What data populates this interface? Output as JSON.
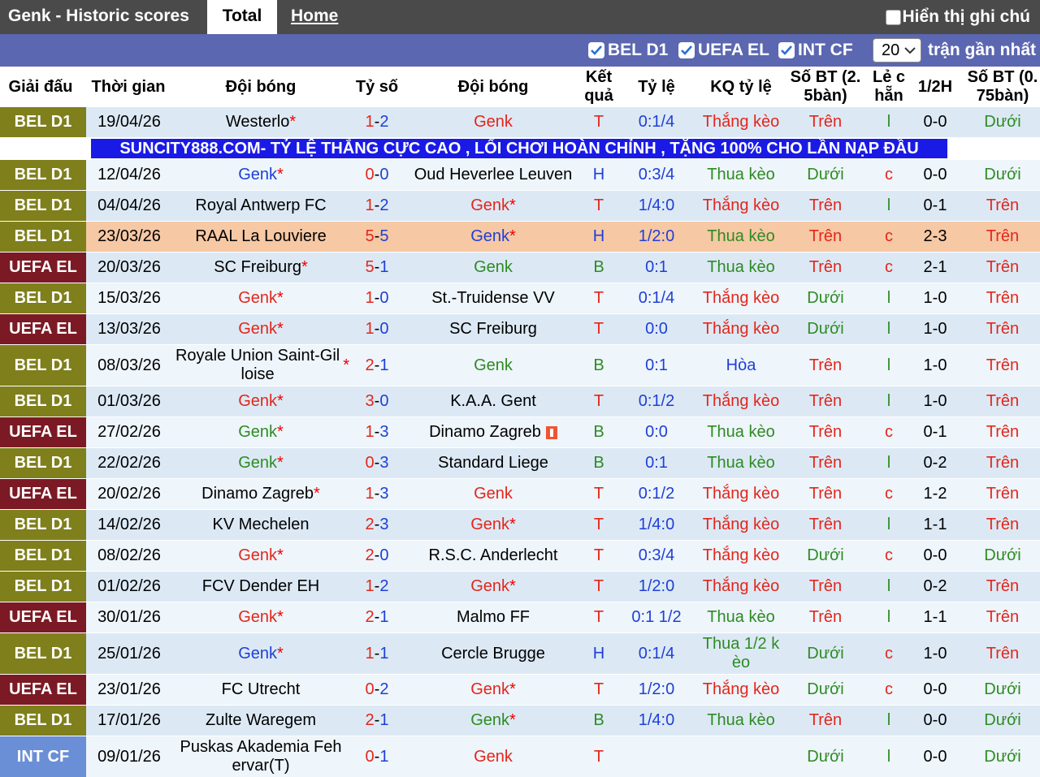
{
  "header": {
    "title": "Genk - Historic scores",
    "tab_total": "Total",
    "tab_home": "Home",
    "show_notes": "Hiển thị ghi chú"
  },
  "filters": {
    "items": [
      "BEL D1",
      "UEFA EL",
      "INT CF"
    ],
    "count_value": "20",
    "count_suffix": "trận gần nhất"
  },
  "columns": {
    "league": "Giải đấu",
    "time": "Thời gian",
    "home": "Đội bóng",
    "score": "Tỷ số",
    "away": "Đội bóng",
    "result": "Kết quả",
    "odds": "Tỷ lệ",
    "odds_result": "KQ tỷ lệ",
    "goals25": "Số BT (2. 5bàn)",
    "oddeven": "Lẻ c hẵn",
    "half": "1/2H",
    "goals075": "Số BT (0. 75bàn)"
  },
  "banner": "SUNCITY888.COM- TỶ LỆ THẮNG CỰC CAO , LỐI CHƠI HOÀN CHỈNH , TẶNG 100% CHO LẦN NẠP ĐẦU",
  "colors": {
    "bel_d1": "#7f7f1c",
    "uefa_el": "#7b1a24",
    "int_cf": "#6b8fd6",
    "row_light": "#dce9f5",
    "row_white": "#eef5fb",
    "row_highlight": "#f6c8a4",
    "red": "#e3261b",
    "blue": "#1f3fd6",
    "green": "#2e8b22"
  },
  "matches": [
    {
      "league": "BEL D1",
      "lt": "bel",
      "date": "19/04/26",
      "home": "Westerlo",
      "hs": true,
      "hc": "k",
      "score_h": "1",
      "score_a": "2",
      "away": "Genk",
      "as": false,
      "ac": "r",
      "res": "T",
      "rc": "r",
      "odds": "0:1/4",
      "kq": "Thắng kèo",
      "kc": "r",
      "g25": "Trên",
      "gc": "r",
      "oe": "l",
      "oc": "g",
      "half": "0-0",
      "g075": "Dưới",
      "g2c": "g",
      "bg": "light",
      "banner_after": true
    },
    {
      "league": "BEL D1",
      "lt": "bel",
      "date": "12/04/26",
      "home": "Genk",
      "hs": true,
      "hc": "b",
      "score_h": "0",
      "score_a": "0",
      "away": "Oud Heverlee Leuven",
      "as": false,
      "ac": "k",
      "res": "H",
      "rc": "b",
      "odds": "0:3/4",
      "kq": "Thua kèo",
      "kc": "g",
      "g25": "Dưới",
      "gc": "g",
      "oe": "c",
      "oc": "r",
      "half": "0-0",
      "g075": "Dưới",
      "g2c": "g",
      "bg": "white"
    },
    {
      "league": "BEL D1",
      "lt": "bel",
      "date": "04/04/26",
      "home": "Royal Antwerp FC",
      "hs": false,
      "hc": "k",
      "score_h": "1",
      "score_a": "2",
      "away": "Genk",
      "as": true,
      "ac": "r",
      "res": "T",
      "rc": "r",
      "odds": "1/4:0",
      "kq": "Thắng kèo",
      "kc": "r",
      "g25": "Trên",
      "gc": "r",
      "oe": "l",
      "oc": "g",
      "half": "0-1",
      "g075": "Trên",
      "g2c": "r",
      "bg": "light"
    },
    {
      "league": "BEL D1",
      "lt": "bel",
      "date": "23/03/26",
      "home": "RAAL La Louviere",
      "hs": false,
      "hc": "k",
      "score_h": "5",
      "score_a": "5",
      "away": "Genk",
      "as": true,
      "ac": "b",
      "res": "H",
      "rc": "b",
      "odds": "1/2:0",
      "kq": "Thua kèo",
      "kc": "g",
      "g25": "Trên",
      "gc": "r",
      "oe": "c",
      "oc": "r",
      "half": "2-3",
      "g075": "Trên",
      "g2c": "r",
      "bg": "highlight"
    },
    {
      "league": "UEFA EL",
      "lt": "uefa",
      "date": "20/03/26",
      "home": "SC Freiburg",
      "hs": true,
      "hc": "k",
      "score_h": "5",
      "score_a": "1",
      "away": "Genk",
      "as": false,
      "ac": "g",
      "res": "B",
      "rc": "g",
      "odds": "0:1",
      "kq": "Thua kèo",
      "kc": "g",
      "g25": "Trên",
      "gc": "r",
      "oe": "c",
      "oc": "r",
      "half": "2-1",
      "g075": "Trên",
      "g2c": "r",
      "bg": "light"
    },
    {
      "league": "BEL D1",
      "lt": "bel",
      "date": "15/03/26",
      "home": "Genk",
      "hs": true,
      "hc": "r",
      "score_h": "1",
      "score_a": "0",
      "away": "St.-Truidense VV",
      "as": false,
      "ac": "k",
      "res": "T",
      "rc": "r",
      "odds": "0:1/4",
      "kq": "Thắng kèo",
      "kc": "r",
      "g25": "Dưới",
      "gc": "g",
      "oe": "l",
      "oc": "g",
      "half": "1-0",
      "g075": "Trên",
      "g2c": "r",
      "bg": "white"
    },
    {
      "league": "UEFA EL",
      "lt": "uefa",
      "date": "13/03/26",
      "home": "Genk",
      "hs": true,
      "hc": "r",
      "score_h": "1",
      "score_a": "0",
      "away": "SC Freiburg",
      "as": false,
      "ac": "k",
      "res": "T",
      "rc": "r",
      "odds": "0:0",
      "kq": "Thắng kèo",
      "kc": "r",
      "g25": "Dưới",
      "gc": "g",
      "oe": "l",
      "oc": "g",
      "half": "1-0",
      "g075": "Trên",
      "g2c": "r",
      "bg": "light"
    },
    {
      "league": "BEL D1",
      "lt": "bel",
      "date": "08/03/26",
      "home": "Royale Union Saint-Gil loise",
      "hs": true,
      "hc": "k",
      "score_h": "2",
      "score_a": "1",
      "away": "Genk",
      "as": false,
      "ac": "g",
      "res": "B",
      "rc": "g",
      "odds": "0:1",
      "kq": "Hòa",
      "kc": "b",
      "g25": "Trên",
      "gc": "r",
      "oe": "l",
      "oc": "g",
      "half": "1-0",
      "g075": "Trên",
      "g2c": "r",
      "bg": "white",
      "tall": true
    },
    {
      "league": "BEL D1",
      "lt": "bel",
      "date": "01/03/26",
      "home": "Genk",
      "hs": true,
      "hc": "r",
      "score_h": "3",
      "score_a": "0",
      "away": "K.A.A. Gent",
      "as": false,
      "ac": "k",
      "res": "T",
      "rc": "r",
      "odds": "0:1/2",
      "kq": "Thắng kèo",
      "kc": "r",
      "g25": "Trên",
      "gc": "r",
      "oe": "l",
      "oc": "g",
      "half": "1-0",
      "g075": "Trên",
      "g2c": "r",
      "bg": "light"
    },
    {
      "league": "UEFA EL",
      "lt": "uefa",
      "date": "27/02/26",
      "home": "Genk",
      "hs": true,
      "hc": "g",
      "score_h": "1",
      "score_a": "3",
      "away": "Dinamo Zagreb",
      "as": false,
      "ac": "k",
      "flag": true,
      "res": "B",
      "rc": "g",
      "odds": "0:0",
      "kq": "Thua kèo",
      "kc": "g",
      "g25": "Trên",
      "gc": "r",
      "oe": "c",
      "oc": "r",
      "half": "0-1",
      "g075": "Trên",
      "g2c": "r",
      "bg": "white"
    },
    {
      "league": "BEL D1",
      "lt": "bel",
      "date": "22/02/26",
      "home": "Genk",
      "hs": true,
      "hc": "g",
      "score_h": "0",
      "score_a": "3",
      "away": "Standard Liege",
      "as": false,
      "ac": "k",
      "res": "B",
      "rc": "g",
      "odds": "0:1",
      "kq": "Thua kèo",
      "kc": "g",
      "g25": "Trên",
      "gc": "r",
      "oe": "l",
      "oc": "g",
      "half": "0-2",
      "g075": "Trên",
      "g2c": "r",
      "bg": "light"
    },
    {
      "league": "UEFA EL",
      "lt": "uefa",
      "date": "20/02/26",
      "home": "Dinamo Zagreb",
      "hs": true,
      "hc": "k",
      "score_h": "1",
      "score_a": "3",
      "away": "Genk",
      "as": false,
      "ac": "r",
      "res": "T",
      "rc": "r",
      "odds": "0:1/2",
      "kq": "Thắng kèo",
      "kc": "r",
      "g25": "Trên",
      "gc": "r",
      "oe": "c",
      "oc": "r",
      "half": "1-2",
      "g075": "Trên",
      "g2c": "r",
      "bg": "white"
    },
    {
      "league": "BEL D1",
      "lt": "bel",
      "date": "14/02/26",
      "home": "KV Mechelen",
      "hs": false,
      "hc": "k",
      "score_h": "2",
      "score_a": "3",
      "away": "Genk",
      "as": true,
      "ac": "r",
      "res": "T",
      "rc": "r",
      "odds": "1/4:0",
      "kq": "Thắng kèo",
      "kc": "r",
      "g25": "Trên",
      "gc": "r",
      "oe": "l",
      "oc": "g",
      "half": "1-1",
      "g075": "Trên",
      "g2c": "r",
      "bg": "light"
    },
    {
      "league": "BEL D1",
      "lt": "bel",
      "date": "08/02/26",
      "home": "Genk",
      "hs": true,
      "hc": "r",
      "score_h": "2",
      "score_a": "0",
      "away": "R.S.C. Anderlecht",
      "as": false,
      "ac": "k",
      "res": "T",
      "rc": "r",
      "odds": "0:3/4",
      "kq": "Thắng kèo",
      "kc": "r",
      "g25": "Dưới",
      "gc": "g",
      "oe": "c",
      "oc": "r",
      "half": "0-0",
      "g075": "Dưới",
      "g2c": "g",
      "bg": "white"
    },
    {
      "league": "BEL D1",
      "lt": "bel",
      "date": "01/02/26",
      "home": "FCV Dender EH",
      "hs": false,
      "hc": "k",
      "score_h": "1",
      "score_a": "2",
      "away": "Genk",
      "as": true,
      "ac": "r",
      "res": "T",
      "rc": "r",
      "odds": "1/2:0",
      "kq": "Thắng kèo",
      "kc": "r",
      "g25": "Trên",
      "gc": "r",
      "oe": "l",
      "oc": "g",
      "half": "0-2",
      "g075": "Trên",
      "g2c": "r",
      "bg": "light"
    },
    {
      "league": "UEFA EL",
      "lt": "uefa",
      "date": "30/01/26",
      "home": "Genk",
      "hs": true,
      "hc": "r",
      "score_h": "2",
      "score_a": "1",
      "away": "Malmo FF",
      "as": false,
      "ac": "k",
      "res": "T",
      "rc": "r",
      "odds": "0:1 1/2",
      "kq": "Thua kèo",
      "kc": "g",
      "g25": "Trên",
      "gc": "r",
      "oe": "l",
      "oc": "g",
      "half": "1-1",
      "g075": "Trên",
      "g2c": "r",
      "bg": "white"
    },
    {
      "league": "BEL D1",
      "lt": "bel",
      "date": "25/01/26",
      "home": "Genk",
      "hs": true,
      "hc": "b",
      "score_h": "1",
      "score_a": "1",
      "away": "Cercle Brugge",
      "as": false,
      "ac": "k",
      "res": "H",
      "rc": "b",
      "odds": "0:1/4",
      "kq": "Thua 1/2 k èo",
      "kc": "g",
      "g25": "Dưới",
      "gc": "g",
      "oe": "c",
      "oc": "r",
      "half": "1-0",
      "g075": "Trên",
      "g2c": "r",
      "bg": "light",
      "tall": true
    },
    {
      "league": "UEFA EL",
      "lt": "uefa",
      "date": "23/01/26",
      "home": "FC Utrecht",
      "hs": false,
      "hc": "k",
      "score_h": "0",
      "score_a": "2",
      "away": "Genk",
      "as": true,
      "ac": "r",
      "res": "T",
      "rc": "r",
      "odds": "1/2:0",
      "kq": "Thắng kèo",
      "kc": "r",
      "g25": "Dưới",
      "gc": "g",
      "oe": "c",
      "oc": "r",
      "half": "0-0",
      "g075": "Dưới",
      "g2c": "g",
      "bg": "white"
    },
    {
      "league": "BEL D1",
      "lt": "bel",
      "date": "17/01/26",
      "home": "Zulte Waregem",
      "hs": false,
      "hc": "k",
      "score_h": "2",
      "score_a": "1",
      "away": "Genk",
      "as": true,
      "ac": "g",
      "res": "B",
      "rc": "g",
      "odds": "1/4:0",
      "kq": "Thua kèo",
      "kc": "g",
      "g25": "Trên",
      "gc": "r",
      "oe": "l",
      "oc": "g",
      "half": "0-0",
      "g075": "Dưới",
      "g2c": "g",
      "bg": "light"
    },
    {
      "league": "INT CF",
      "lt": "int",
      "date": "09/01/26",
      "home": "Puskas Akademia Feh ervar(T)",
      "hs": false,
      "hc": "k",
      "score_h": "0",
      "score_a": "1",
      "away": "Genk",
      "as": false,
      "ac": "r",
      "res": "T",
      "rc": "r",
      "odds": "",
      "kq": "",
      "kc": "r",
      "g25": "Dưới",
      "gc": "g",
      "oe": "l",
      "oc": "g",
      "half": "0-0",
      "g075": "Dưới",
      "g2c": "g",
      "bg": "white",
      "tall": true
    }
  ]
}
